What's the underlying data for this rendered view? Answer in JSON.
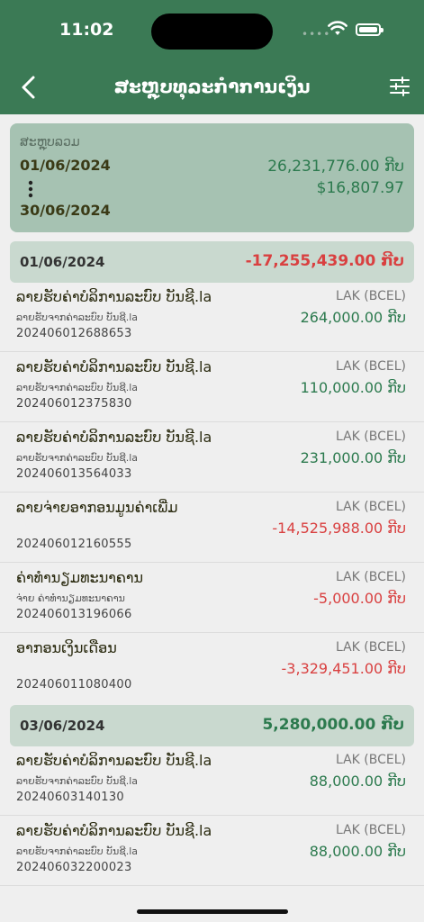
{
  "status": {
    "time": "11:02",
    "signal": "••••"
  },
  "header": {
    "title": "ສະຫຼຸບທຸລະກຳການເງິນ"
  },
  "summary": {
    "label": "ສະຫຼຸບລວມ",
    "from": "01/06/2024",
    "to": "30/06/2024",
    "total_lak": "26,231,776.00 ກີບ",
    "total_usd": "$16,807.97"
  },
  "groups": [
    {
      "date": "01/06/2024",
      "amount": "-17,255,439.00 ກີບ",
      "items": [
        {
          "name": "ລາຍຮັບຄ່າບໍລິການລະບົບ ບັນຊີ.la",
          "sub": "ລາຍຮັບຈາກຄ່າລະບົບ ບັນຊີ.la",
          "ref": "202406012688653",
          "currency": "LAK (BCEL)",
          "amount": "264,000.00 ກີບ"
        },
        {
          "name": "ລາຍຮັບຄ່າບໍລິການລະບົບ ບັນຊີ.la",
          "sub": "ລາຍຮັບຈາກຄ່າລະບົບ ບັນຊີ.la",
          "ref": "202406012375830",
          "currency": "LAK (BCEL)",
          "amount": "110,000.00 ກີບ"
        },
        {
          "name": "ລາຍຮັບຄ່າບໍລິການລະບົບ ບັນຊີ.la",
          "sub": "ລາຍຮັບຈາກຄ່າລະບົບ ບັນຊີ.la",
          "ref": "202406013564033",
          "currency": "LAK (BCEL)",
          "amount": "231,000.00 ກີບ"
        },
        {
          "name": "ລາຍຈ່າຍອາກອນມູນຄ່າເພີ່ມ",
          "sub": "",
          "ref": "202406012160555",
          "currency": "LAK (BCEL)",
          "amount": "-14,525,988.00 ກີບ"
        },
        {
          "name": "ຄ່າທຳນຽມທະນາຄານ",
          "sub": "ຈ່າຍ ຄ່າທຳນຽມທະນາຄານ",
          "ref": "202406013196066",
          "currency": "LAK (BCEL)",
          "amount": "-5,000.00 ກີບ"
        },
        {
          "name": "ອາກອນເງິນເດືອນ",
          "sub": "",
          "ref": "202406011080400",
          "currency": "LAK (BCEL)",
          "amount": "-3,329,451.00 ກີບ"
        }
      ]
    },
    {
      "date": "03/06/2024",
      "amount": "5,280,000.00 ກີບ",
      "items": [
        {
          "name": "ລາຍຮັບຄ່າບໍລິການລະບົບ ບັນຊີ.la",
          "sub": "ລາຍຮັບຈາກຄ່າລະບົບ ບັນຊີ.la",
          "ref": "20240603140130",
          "currency": "LAK (BCEL)",
          "amount": "88,000.00 ກີບ"
        },
        {
          "name": "ລາຍຮັບຄ່າບໍລິການລະບົບ ບັນຊີ.la",
          "sub": "ລາຍຮັບຈາກຄ່າລະບົບ ບັນຊີ.la",
          "ref": "202406032200023",
          "currency": "LAK (BCEL)",
          "amount": "88,000.00 ກີບ"
        }
      ]
    }
  ],
  "colors": {
    "header": "#3b7a55",
    "positive": "#2c7a4e",
    "negative": "#d94040",
    "summary_bg": "#a6c2b2",
    "day_bg": "#c9d9cf"
  },
  "icons": {
    "back": "chevron-left-icon",
    "filter": "sliders-icon",
    "more": "vertical-dots-icon"
  }
}
